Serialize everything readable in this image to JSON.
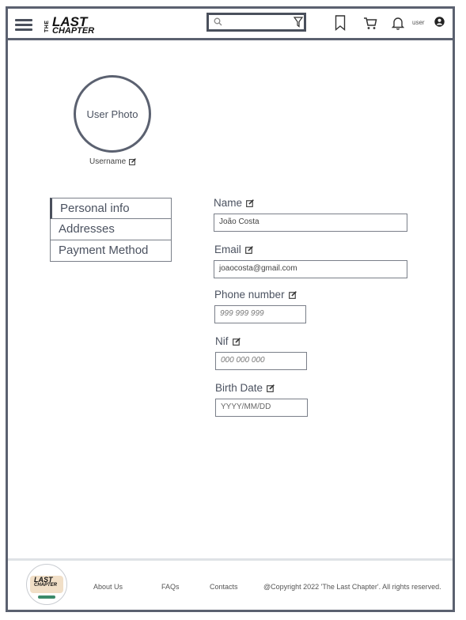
{
  "header": {
    "logo": {
      "the": "THE",
      "last": "LAST",
      "chapter": "CHAPTER"
    },
    "search": {
      "placeholder": "",
      "value": ""
    },
    "icons": [
      "menu-icon",
      "search-icon",
      "filter-icon",
      "bookmark-icon",
      "cart-icon",
      "bell-icon",
      "user-icon"
    ],
    "user_label": "user"
  },
  "profile": {
    "photo_label": "User Photo",
    "username": "Username"
  },
  "menu": {
    "items": [
      {
        "label": "Personal info"
      },
      {
        "label": "Addresses"
      },
      {
        "label": "Payment Method"
      }
    ]
  },
  "form": {
    "name": {
      "label": "Name",
      "value": "João Costa"
    },
    "email": {
      "label": "Email",
      "value": "joaocosta@gmail.com"
    },
    "phone": {
      "label": "Phone number",
      "value": "999 999 999"
    },
    "nif": {
      "label": "Nif",
      "value": "000 000 000"
    },
    "birth": {
      "label": "Birth Date",
      "value": "YYYY/MM/DD"
    }
  },
  "footer": {
    "logo": {
      "last": "LAST",
      "chapter": "CHAPTER"
    },
    "links": {
      "about": "About Us",
      "faqs": "FAQs",
      "contacts": "Contacts"
    },
    "copyright": "@Copyright 2022 'The Last Chapter'. All rights reserved."
  },
  "colors": {
    "border": "#5b6170",
    "text": "#3f4652",
    "accent_green": "#3a8a6a"
  }
}
